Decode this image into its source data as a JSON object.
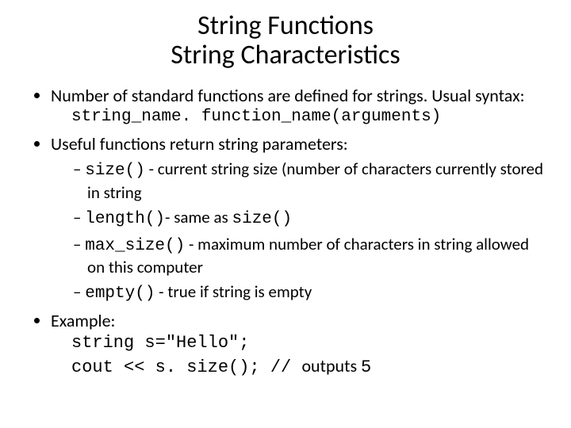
{
  "title_line1": "String Functions",
  "title_line2": "String Characteristics",
  "b1_text": "Number of standard functions are defined for strings. Usual syntax:",
  "b1_syntax": "string_name. function_name(arguments)",
  "b2_text": "Useful functions return string parameters:",
  "sub1_code": "size()",
  "sub1_rest": " -  current string size (number of characters currently stored in string",
  "sub2_code": "length()",
  "sub2_mid": "- same as ",
  "sub2_code2": "size()",
  "sub3_code": "max_size()",
  "sub3_rest": "  - maximum number of characters in string allowed on this computer",
  "sub4_code": "empty()",
  "sub4_rest": " - true if string is empty",
  "b3_text": "Example:",
  "ex_line1": "string s=\"Hello\";",
  "ex_line2a": "cout << s. size(); // ",
  "ex_line2b": "outputs ",
  "ex_line2c": "5"
}
